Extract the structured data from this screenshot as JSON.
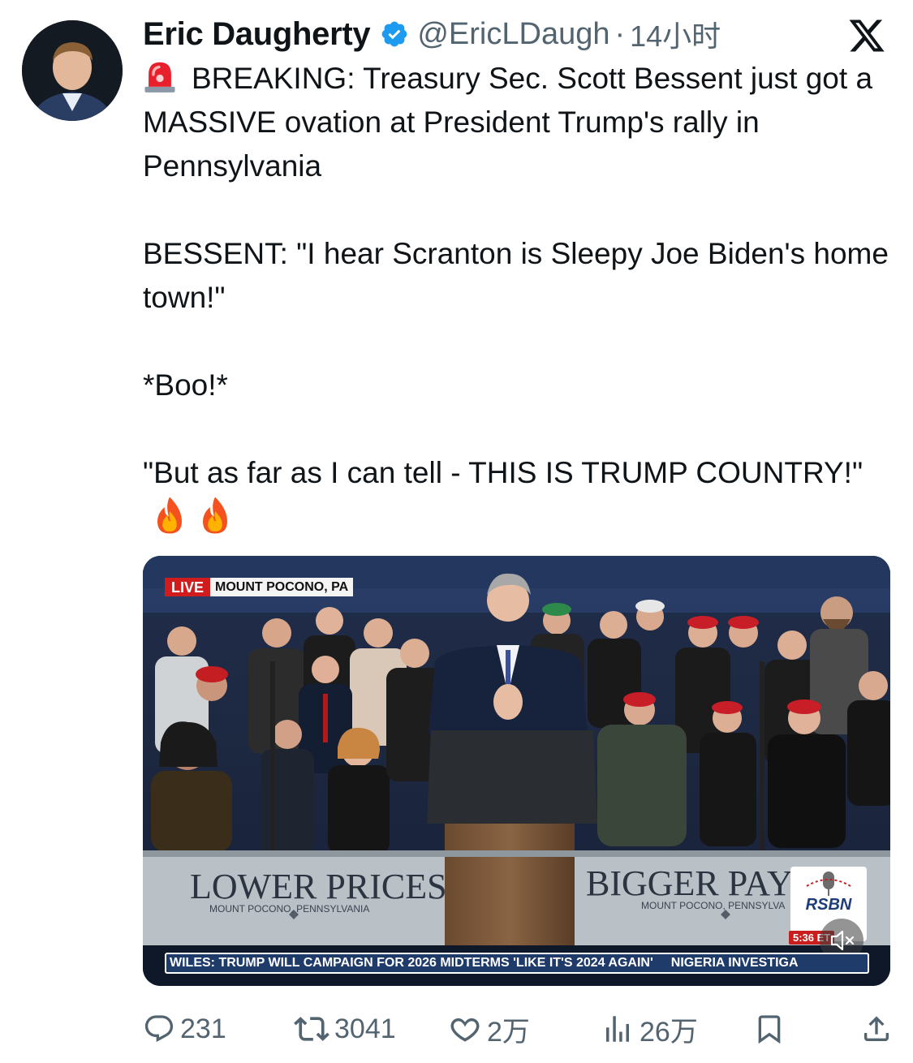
{
  "tweet": {
    "author_name": "Eric Daugherty",
    "handle": "@EricLDaugh",
    "separator": "·",
    "time": "14小时",
    "verified": true,
    "paragraphs": [
      "BREAKING: Treasury Sec. Scott Bessent just got a MASSIVE ovation at President Trump's rally in Pennsylvania",
      "BESSENT: \"I hear Scranton is Sleepy Joe Biden's home town!\"",
      "*Boo!*",
      "\"But as far as I can tell - THIS IS TRUMP COUNTRY!\""
    ]
  },
  "media": {
    "live_label": "LIVE",
    "location": "MOUNT POCONO, PA",
    "banner_left": "LOWER PRICES",
    "banner_left_sub": "MOUNT POCONO, PENNSYLVANIA",
    "banner_right": "BIGGER PAYCH",
    "banner_right_sub": "MOUNT POCONO, PENNSYLVA",
    "network_logo": "RSBN",
    "clock": "5:36 ET",
    "ticker": [
      "WILES: TRUMP WILL CAMPAIGN FOR 2026 MIDTERMS 'LIKE IT'S 2024 AGAIN'",
      "NIGERIA INVESTIGA"
    ]
  },
  "actions": {
    "replies": "231",
    "reposts": "3041",
    "likes": "2万",
    "views": "26万"
  },
  "colors": {
    "text": "#0f1419",
    "secondary": "#536471",
    "verified": "#1d9bf0"
  },
  "icons": [
    "siren-emoji",
    "fire-emoji",
    "verified-badge-icon",
    "x-logo-icon",
    "reply-icon",
    "repost-icon",
    "like-icon",
    "views-icon",
    "bookmark-icon",
    "share-icon",
    "mute-icon"
  ]
}
